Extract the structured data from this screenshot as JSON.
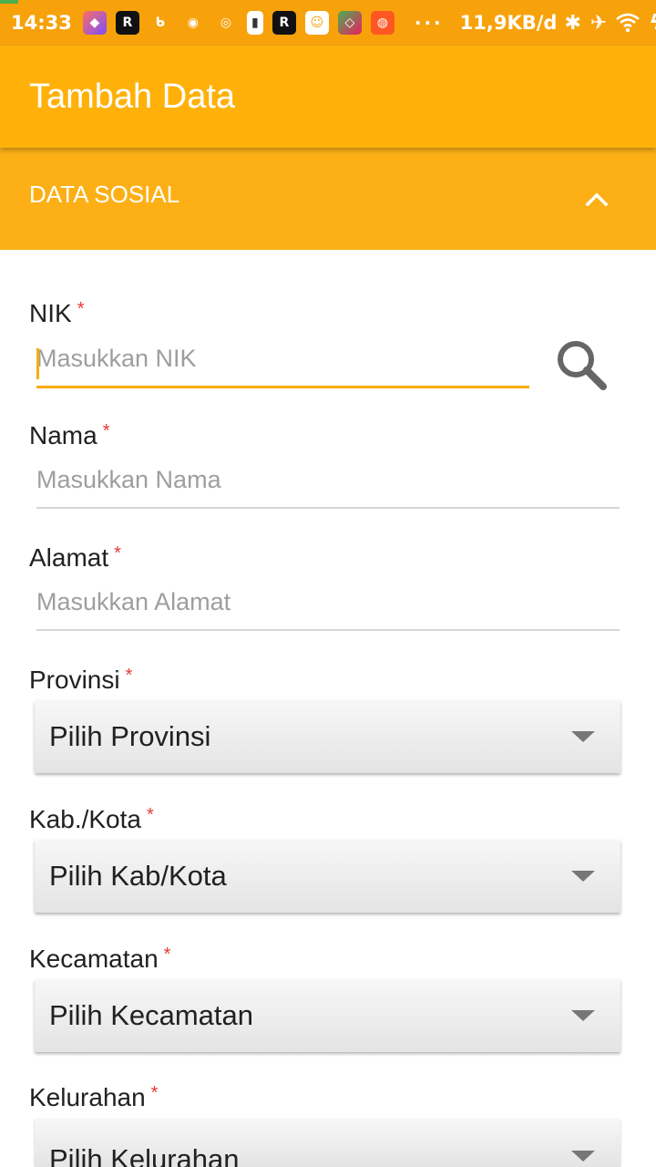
{
  "status_bar": {
    "time": "14:33",
    "network_speed": "11,9KB/d",
    "more_dots": "···",
    "notification_icons": [
      "app-icon-1",
      "app-icon-2",
      "app-icon-3",
      "app-icon-4",
      "app-icon-5",
      "app-icon-6",
      "app-icon-7",
      "app-icon-8",
      "app-icon-9",
      "app-icon-10"
    ],
    "colors": {
      "background": "#f7a20b"
    }
  },
  "app_bar": {
    "title": "Tambah Data",
    "color": "#ffb10a"
  },
  "section": {
    "title": "DATA SOSIAL",
    "icon": "chevron-up-icon"
  },
  "form": {
    "required_marker": "*",
    "nik": {
      "label": "NIK",
      "placeholder": "Masukkan NIK",
      "value": ""
    },
    "nama": {
      "label": "Nama",
      "placeholder": "Masukkan Nama",
      "value": ""
    },
    "alamat": {
      "label": "Alamat",
      "placeholder": "Masukkan Alamat",
      "value": ""
    },
    "provinsi": {
      "label": "Provinsi",
      "selected": "Pilih Provinsi"
    },
    "kota": {
      "label": "Kab./Kota",
      "selected": "Pilih Kab/Kota"
    },
    "kecamatan": {
      "label": "Kecamatan",
      "selected": "Pilih Kecamatan"
    },
    "kelurahan": {
      "label": "Kelurahan",
      "selected": "Pilih Kelurahan"
    }
  },
  "colors": {
    "accent": "#f9ad0c",
    "required": "#e53935"
  }
}
